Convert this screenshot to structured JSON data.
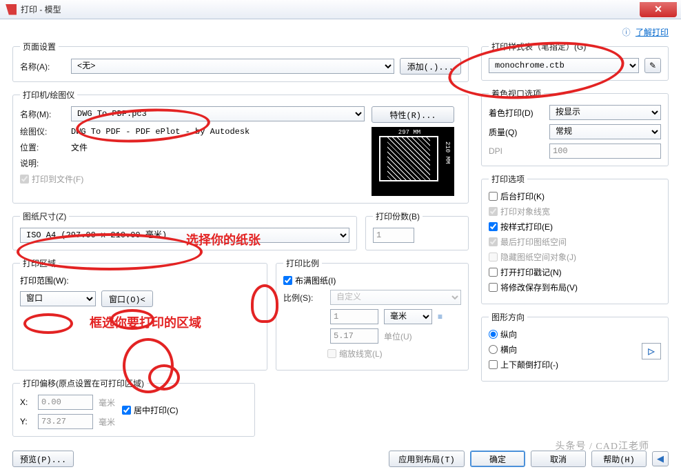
{
  "window": {
    "title": "打印 - 模型"
  },
  "link": {
    "learn": "了解打印"
  },
  "page_setup": {
    "legend": "页面设置",
    "name_label": "名称(A):",
    "name_value": "<无>",
    "add_btn": "添加(.)..."
  },
  "plot_style": {
    "legend": "打印样式表（笔指定）(G)",
    "value": "monochrome.ctb"
  },
  "printer": {
    "legend": "打印机/绘图仪",
    "name_label": "名称(M):",
    "name_value": "DWG To PDF.pc3",
    "props_btn": "特性(R)...",
    "plotter_label": "绘图仪:",
    "plotter_value": "DWG To PDF - PDF ePlot - by Autodesk",
    "location_label": "位置:",
    "location_value": "文件",
    "desc_label": "说明:",
    "desc_value": "",
    "plot_to_file": "打印到文件(F)",
    "preview": {
      "w": "297 MM",
      "h": "210 MM"
    }
  },
  "paper": {
    "legend": "图纸尺寸(Z)",
    "value": "ISO A4 (297.00 x 210.00 毫米)"
  },
  "copies": {
    "legend": "打印份数(B)",
    "value": "1"
  },
  "area": {
    "legend": "打印区域",
    "what_label": "打印范围(W):",
    "what_value": "窗口",
    "window_btn": "窗口(O)<"
  },
  "scale": {
    "legend": "打印比例",
    "fit": "布满图纸(I)",
    "scale_label": "比例(S):",
    "scale_value": "自定义",
    "unit_value": "1",
    "unit_label": "毫米",
    "drawing_value": "5.17",
    "drawing_label": "单位(U)",
    "scale_lw": "缩放线宽(L)"
  },
  "offset": {
    "legend": "打印偏移(原点设置在可打印区域)",
    "x_label": "X:",
    "x_value": "0.00",
    "x_unit": "毫米",
    "y_label": "Y:",
    "y_value": "73.27",
    "y_unit": "毫米",
    "center": "居中打印(C)"
  },
  "shaded": {
    "legend": "着色视口选项",
    "shade_label": "着色打印(D)",
    "shade_value": "按显示",
    "quality_label": "质量(Q)",
    "quality_value": "常规",
    "dpi_label": "DPI",
    "dpi_value": "100"
  },
  "options": {
    "legend": "打印选项",
    "bg": "后台打印(K)",
    "lw": "打印对象线宽",
    "styles": "按样式打印(E)",
    "paperspace_last": "最后打印图纸空间",
    "hide_paperspace": "隐藏图纸空间对象(J)",
    "stamp": "打开打印戳记(N)",
    "save_layout": "将修改保存到布局(V)"
  },
  "orientation": {
    "legend": "图形方向",
    "portrait": "纵向",
    "landscape": "横向",
    "upside": "上下颠倒打印(-)"
  },
  "buttons": {
    "preview": "预览(P)...",
    "apply": "应用到布局(T)",
    "ok": "确定",
    "cancel": "取消",
    "help": "帮助(H)"
  },
  "annotations": {
    "paper": "选择你的纸张",
    "area": "框选你要打印的区域"
  },
  "watermark": "头条号 / CAD江老师"
}
